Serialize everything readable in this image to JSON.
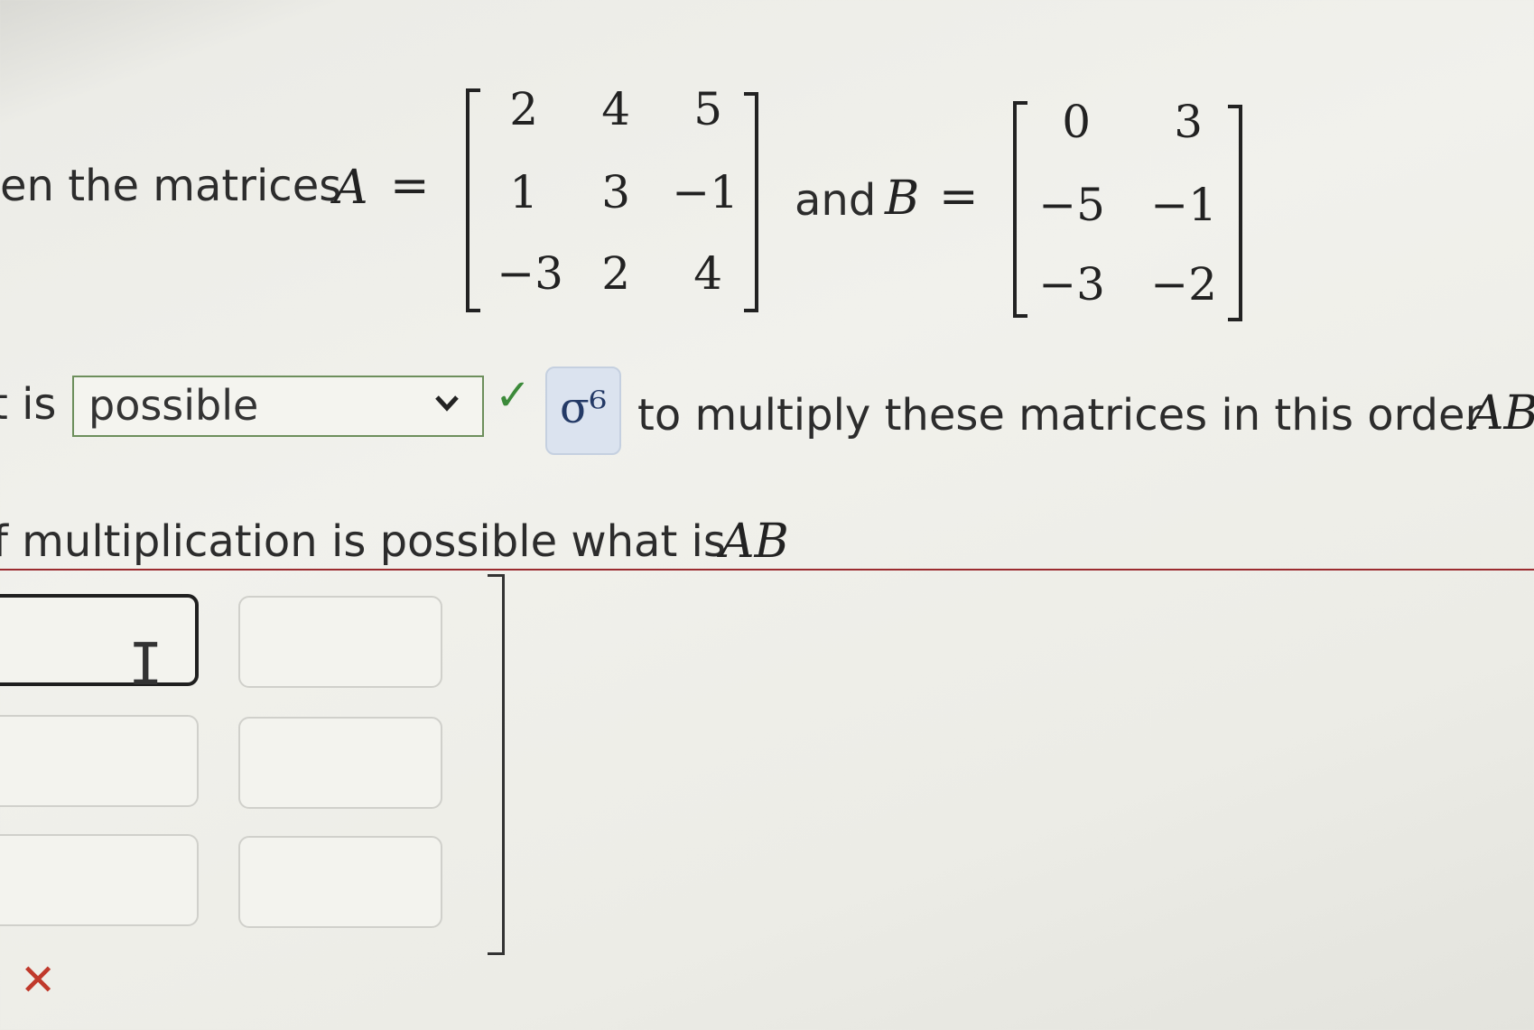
{
  "question": {
    "line1_prefix": "en the matrices",
    "matrix_a_name": "A",
    "equals": "=",
    "and_word": "and",
    "matrix_b_name": "B",
    "matrix_a": [
      [
        "2",
        "4",
        "5"
      ],
      [
        "1",
        "3",
        "−1"
      ],
      [
        "−3",
        "2",
        "4"
      ]
    ],
    "matrix_b": [
      [
        "0",
        "3"
      ],
      [
        "−5",
        "−1"
      ],
      [
        "−3",
        "−2"
      ]
    ]
  },
  "answer_line": {
    "prefix": "t is",
    "dropdown_value": "possible",
    "chevron_icon": "chevron-down-icon",
    "check_icon": "✓",
    "check_color": "#3c8a3a",
    "icon_button_glyph": "σ⁶",
    "suffix": "to multiply these matrices in this order",
    "suffix_math": "AB"
  },
  "second_question": {
    "prefix": "f multiplication is possible what is",
    "math": "AB"
  },
  "result_matrix": {
    "cells": [
      [
        "",
        ""
      ],
      [
        "",
        ""
      ],
      [
        "",
        ""
      ]
    ],
    "cursor_glyph": "I"
  },
  "status": {
    "x_mark": "✕",
    "x_color": "#c0392b",
    "rule_color": "#9b2b2f"
  }
}
